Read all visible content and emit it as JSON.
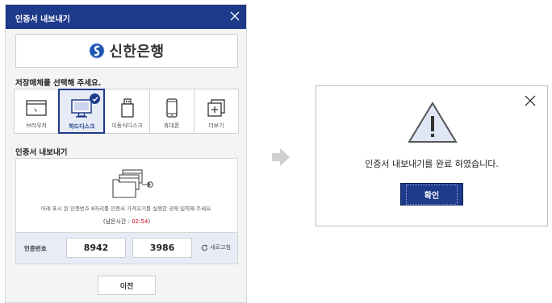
{
  "dialog": {
    "title": "인증서 내보내기",
    "bank_name": "신한은행",
    "media_prompt": "저장매체를 선택해 주세요.",
    "media": [
      {
        "label": "브라우저",
        "icon": "browser-icon",
        "selected": false
      },
      {
        "label": "하드디스크",
        "icon": "monitor-icon",
        "selected": true
      },
      {
        "label": "이동식디스크",
        "icon": "usb-icon",
        "selected": false
      },
      {
        "label": "휴대폰",
        "icon": "phone-icon",
        "selected": false
      },
      {
        "label": "더보기",
        "icon": "more-icon",
        "selected": false
      }
    ],
    "export_section_title": "인증서 내보내기",
    "export_description": "아래 표시 된 인증번호 8자리를 인증서 가져오기를 실행한 곳에 입력해 주세요.",
    "remaining_label": "(남은시간 : ",
    "remaining_time": "02:54",
    "remaining_suffix": ")",
    "code_label": "인증번호",
    "code_part1": "8942",
    "code_part2": "3986",
    "refresh_label": "새로고침",
    "prev_button": "이전"
  },
  "alert": {
    "message": "인증서 내보내기를 완료 하였습니다.",
    "ok_button": "확인"
  },
  "colors": {
    "brand_navy": "#1e3a8a",
    "timer_red": "#d0021b",
    "code_row_bg": "#e7ecf7"
  }
}
